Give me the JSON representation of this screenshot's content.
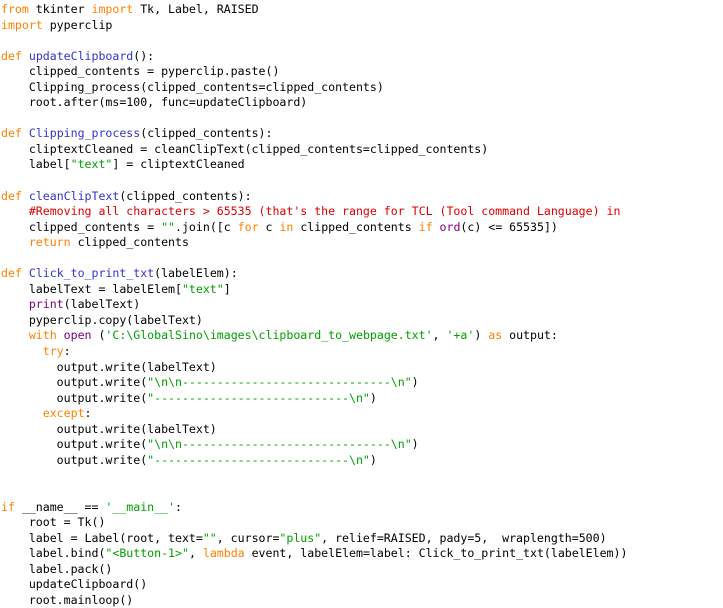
{
  "document": {
    "type": "python-source-listing",
    "language": "Python",
    "colors": {
      "background": "#ffffff",
      "plain": "#000000",
      "keyword": "#ff8000",
      "function_name": "#3333cc",
      "builtin": "#800080",
      "string": "#00a000",
      "comment": "#dd0000"
    }
  },
  "code": {
    "lines": [
      {
        "id": 1,
        "tokens": [
          {
            "t": "from",
            "c": "kw"
          },
          {
            "t": " tkinter ",
            "c": "pl"
          },
          {
            "t": "import",
            "c": "kw"
          },
          {
            "t": " Tk, Label, RAISED",
            "c": "pl"
          }
        ]
      },
      {
        "id": 2,
        "tokens": [
          {
            "t": "import",
            "c": "kw"
          },
          {
            "t": " pyperclip",
            "c": "pl"
          }
        ]
      },
      {
        "id": 3,
        "tokens": []
      },
      {
        "id": 4,
        "tokens": [
          {
            "t": "def",
            "c": "kw"
          },
          {
            "t": " ",
            "c": "pl"
          },
          {
            "t": "updateClipboard",
            "c": "fn"
          },
          {
            "t": "():",
            "c": "pl"
          }
        ]
      },
      {
        "id": 5,
        "tokens": [
          {
            "t": "    clipped_contents = pyperclip.paste()",
            "c": "pl"
          }
        ]
      },
      {
        "id": 6,
        "tokens": [
          {
            "t": "    Clipping_process(clipped_contents=clipped_contents)",
            "c": "pl"
          }
        ]
      },
      {
        "id": 7,
        "tokens": [
          {
            "t": "    root.after(ms=100, func=updateClipboard)",
            "c": "pl"
          }
        ]
      },
      {
        "id": 8,
        "tokens": []
      },
      {
        "id": 9,
        "tokens": [
          {
            "t": "def",
            "c": "kw"
          },
          {
            "t": " ",
            "c": "pl"
          },
          {
            "t": "Clipping_process",
            "c": "fn"
          },
          {
            "t": "(clipped_contents):",
            "c": "pl"
          }
        ]
      },
      {
        "id": 10,
        "tokens": [
          {
            "t": "    cliptextCleaned = cleanClipText(clipped_contents=clipped_contents)",
            "c": "pl"
          }
        ]
      },
      {
        "id": 11,
        "tokens": [
          {
            "t": "    label[",
            "c": "pl"
          },
          {
            "t": "\"text\"",
            "c": "str"
          },
          {
            "t": "] = cliptextCleaned",
            "c": "pl"
          }
        ]
      },
      {
        "id": 12,
        "tokens": []
      },
      {
        "id": 13,
        "tokens": [
          {
            "t": "def",
            "c": "kw"
          },
          {
            "t": " ",
            "c": "pl"
          },
          {
            "t": "cleanClipText",
            "c": "fn"
          },
          {
            "t": "(clipped_contents):",
            "c": "pl"
          }
        ]
      },
      {
        "id": 14,
        "tokens": [
          {
            "t": "    ",
            "c": "pl"
          },
          {
            "t": "#Removing all characters > 65535 (that's the range for TCL (Tool command Language) in",
            "c": "cmt"
          }
        ]
      },
      {
        "id": 15,
        "tokens": [
          {
            "t": "    clipped_contents = ",
            "c": "pl"
          },
          {
            "t": "\"\"",
            "c": "str"
          },
          {
            "t": ".join([c ",
            "c": "pl"
          },
          {
            "t": "for",
            "c": "kw"
          },
          {
            "t": " c ",
            "c": "pl"
          },
          {
            "t": "in",
            "c": "kw"
          },
          {
            "t": " clipped_contents ",
            "c": "pl"
          },
          {
            "t": "if",
            "c": "kw"
          },
          {
            "t": " ",
            "c": "pl"
          },
          {
            "t": "ord",
            "c": "bi"
          },
          {
            "t": "(c) <= 65535])",
            "c": "pl"
          }
        ]
      },
      {
        "id": 16,
        "tokens": [
          {
            "t": "    ",
            "c": "pl"
          },
          {
            "t": "return",
            "c": "kw"
          },
          {
            "t": " clipped_contents",
            "c": "pl"
          }
        ]
      },
      {
        "id": 17,
        "tokens": []
      },
      {
        "id": 18,
        "tokens": [
          {
            "t": "def",
            "c": "kw"
          },
          {
            "t": " ",
            "c": "pl"
          },
          {
            "t": "Click_to_print_txt",
            "c": "fn"
          },
          {
            "t": "(labelElem):",
            "c": "pl"
          }
        ]
      },
      {
        "id": 19,
        "tokens": [
          {
            "t": "    labelText = labelElem[",
            "c": "pl"
          },
          {
            "t": "\"text\"",
            "c": "str"
          },
          {
            "t": "]",
            "c": "pl"
          }
        ]
      },
      {
        "id": 20,
        "tokens": [
          {
            "t": "    ",
            "c": "pl"
          },
          {
            "t": "print",
            "c": "bi"
          },
          {
            "t": "(labelText)",
            "c": "pl"
          }
        ]
      },
      {
        "id": 21,
        "tokens": [
          {
            "t": "    pyperclip.copy(labelText)",
            "c": "pl"
          }
        ]
      },
      {
        "id": 22,
        "tokens": [
          {
            "t": "    ",
            "c": "pl"
          },
          {
            "t": "with",
            "c": "kw"
          },
          {
            "t": " ",
            "c": "pl"
          },
          {
            "t": "open",
            "c": "bi"
          },
          {
            "t": " (",
            "c": "pl"
          },
          {
            "t": "'C:\\GlobalSino\\images\\clipboard_to_webpage.txt'",
            "c": "str"
          },
          {
            "t": ", ",
            "c": "pl"
          },
          {
            "t": "'+a'",
            "c": "str"
          },
          {
            "t": ") ",
            "c": "pl"
          },
          {
            "t": "as",
            "c": "kw"
          },
          {
            "t": " output:",
            "c": "pl"
          }
        ]
      },
      {
        "id": 23,
        "tokens": [
          {
            "t": "      ",
            "c": "pl"
          },
          {
            "t": "try",
            "c": "kw"
          },
          {
            "t": ":",
            "c": "pl"
          }
        ]
      },
      {
        "id": 24,
        "tokens": [
          {
            "t": "        output.write(labelText)",
            "c": "pl"
          }
        ]
      },
      {
        "id": 25,
        "tokens": [
          {
            "t": "        output.write(",
            "c": "pl"
          },
          {
            "t": "\"\\n\\n------------------------------\\n\"",
            "c": "str"
          },
          {
            "t": ")",
            "c": "pl"
          }
        ]
      },
      {
        "id": 26,
        "tokens": [
          {
            "t": "        output.write(",
            "c": "pl"
          },
          {
            "t": "\"----------------------------\\n\"",
            "c": "str"
          },
          {
            "t": ")",
            "c": "pl"
          }
        ]
      },
      {
        "id": 27,
        "tokens": [
          {
            "t": "      ",
            "c": "pl"
          },
          {
            "t": "except",
            "c": "kw"
          },
          {
            "t": ":",
            "c": "pl"
          }
        ]
      },
      {
        "id": 28,
        "tokens": [
          {
            "t": "        output.write(labelText)",
            "c": "pl"
          }
        ]
      },
      {
        "id": 29,
        "tokens": [
          {
            "t": "        output.write(",
            "c": "pl"
          },
          {
            "t": "\"\\n\\n------------------------------\\n\"",
            "c": "str"
          },
          {
            "t": ")",
            "c": "pl"
          }
        ]
      },
      {
        "id": 30,
        "tokens": [
          {
            "t": "        output.write(",
            "c": "pl"
          },
          {
            "t": "\"----------------------------\\n\"",
            "c": "str"
          },
          {
            "t": ")",
            "c": "pl"
          }
        ]
      },
      {
        "id": 31,
        "tokens": []
      },
      {
        "id": 32,
        "tokens": []
      },
      {
        "id": 33,
        "tokens": [
          {
            "t": "if",
            "c": "kw"
          },
          {
            "t": " __name__ == ",
            "c": "pl"
          },
          {
            "t": "'__main__'",
            "c": "str"
          },
          {
            "t": ":",
            "c": "pl"
          }
        ]
      },
      {
        "id": 34,
        "tokens": [
          {
            "t": "    root = Tk()",
            "c": "pl"
          }
        ]
      },
      {
        "id": 35,
        "tokens": [
          {
            "t": "    label = Label(root, text=",
            "c": "pl"
          },
          {
            "t": "\"\"",
            "c": "str"
          },
          {
            "t": ", cursor=",
            "c": "pl"
          },
          {
            "t": "\"plus\"",
            "c": "str"
          },
          {
            "t": ", relief=RAISED, pady=5,  wraplength=500)",
            "c": "pl"
          }
        ]
      },
      {
        "id": 36,
        "tokens": [
          {
            "t": "    label.bind(",
            "c": "pl"
          },
          {
            "t": "\"<Button-1>\"",
            "c": "str"
          },
          {
            "t": ", ",
            "c": "pl"
          },
          {
            "t": "lambda",
            "c": "kw"
          },
          {
            "t": " event, labelElem=label: Click_to_print_txt(labelElem))",
            "c": "pl"
          }
        ]
      },
      {
        "id": 37,
        "tokens": [
          {
            "t": "    label.pack()",
            "c": "pl"
          }
        ]
      },
      {
        "id": 38,
        "tokens": [
          {
            "t": "    updateClipboard()",
            "c": "pl"
          }
        ]
      },
      {
        "id": 39,
        "tokens": [
          {
            "t": "    root.mainloop()",
            "c": "pl"
          }
        ]
      }
    ]
  }
}
